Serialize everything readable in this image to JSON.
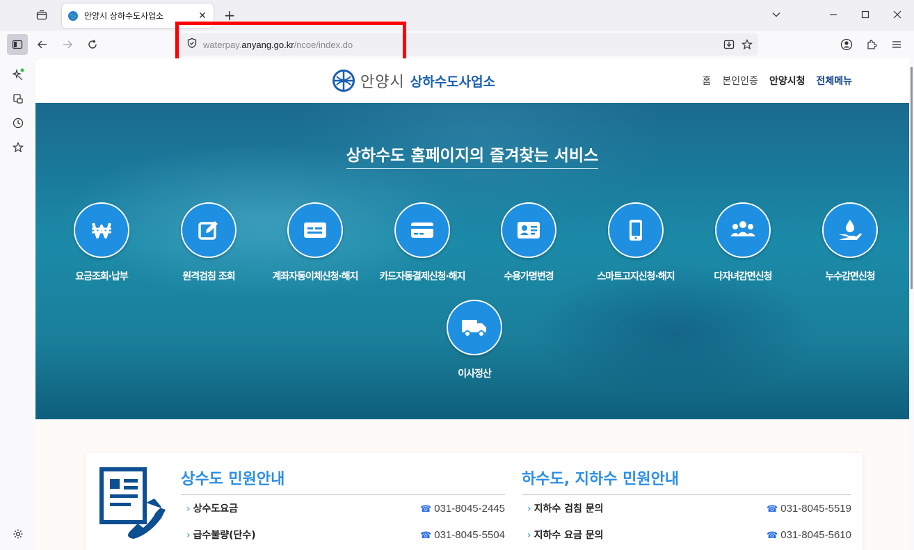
{
  "browser": {
    "tab": {
      "title": "안양시 상하수도사업소"
    },
    "url": {
      "prefix": "waterpay.",
      "host": "anyang.go.kr",
      "path": "/ncoe/index.do"
    }
  },
  "site": {
    "logo": {
      "city": "안양시",
      "office": "상하수도사업소"
    },
    "top_links": [
      "홈",
      "본인인증",
      "안양시청",
      "전체메뉴"
    ],
    "hero_title": "상하수도 홈페이지의 즐겨찾는 서비스",
    "services": [
      {
        "label": "요금조회·납부",
        "icon": "won-icon"
      },
      {
        "label": "원격검침 조회",
        "icon": "edit-icon"
      },
      {
        "label": "계좌자동이체신청·해지",
        "icon": "bank-card-icon"
      },
      {
        "label": "카드자동결제신청·해지",
        "icon": "credit-card-icon"
      },
      {
        "label": "수용가명변경",
        "icon": "id-card-icon"
      },
      {
        "label": "스마트고지신청·해지",
        "icon": "smartphone-icon"
      },
      {
        "label": "다자녀감면신청",
        "icon": "family-icon"
      },
      {
        "label": "누수감면신청",
        "icon": "water-drop-hand-icon"
      },
      {
        "label": "이사정산",
        "icon": "truck-icon"
      }
    ],
    "water_supply": {
      "heading": "상수도 민원안내",
      "items": [
        {
          "name": "상수도요금",
          "phone": "031-8045-2445"
        },
        {
          "name": "급수불량(단수)",
          "phone": "031-8045-5504"
        }
      ]
    },
    "sewage": {
      "heading": "하수도, 지하수 민원안내",
      "items": [
        {
          "name": "지하수 검침 문의",
          "phone": "031-8045-5519"
        },
        {
          "name": "지하수 요금 문의",
          "phone": "031-8045-5610"
        }
      ]
    }
  },
  "colors": {
    "accent": "#1e8fe1",
    "highlight": "#ff0000",
    "brand": "#1a5fb4"
  }
}
